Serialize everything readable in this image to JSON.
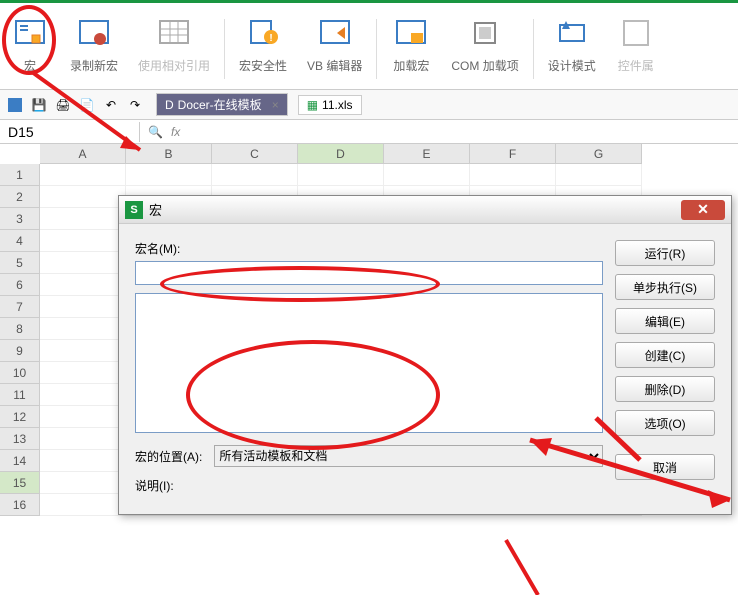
{
  "ribbon": {
    "items": [
      {
        "label": "宏"
      },
      {
        "label": "录制新宏"
      },
      {
        "label": "使用相对引用"
      },
      {
        "label": "宏安全性"
      },
      {
        "label": "VB 编辑器"
      },
      {
        "label": "加载宏"
      },
      {
        "label": "COM 加载项"
      },
      {
        "label": "设计模式"
      },
      {
        "label": "控件属"
      }
    ]
  },
  "tabs": {
    "tab1": {
      "label": "Docer-在线模板"
    },
    "tab2": {
      "label": "11.xls"
    }
  },
  "formula": {
    "cell_ref": "D15",
    "fx": "fx"
  },
  "columns": [
    "A",
    "B",
    "C",
    "D",
    "E",
    "F",
    "G"
  ],
  "rows": [
    "1",
    "2",
    "3",
    "4",
    "5",
    "6",
    "7",
    "8",
    "9",
    "10",
    "11",
    "12",
    "13",
    "14",
    "15",
    "16"
  ],
  "selected_col": "D",
  "selected_row": "15",
  "dialog": {
    "title": "宏",
    "macro_name_label": "宏名(M):",
    "macro_name_value": "",
    "location_label": "宏的位置(A):",
    "location_value": "所有活动模板和文档",
    "description_label": "说明(I):",
    "buttons": {
      "run": "运行(R)",
      "step": "单步执行(S)",
      "edit": "编辑(E)",
      "create": "创建(C)",
      "delete": "删除(D)",
      "options": "选项(O)",
      "cancel": "取消"
    }
  }
}
